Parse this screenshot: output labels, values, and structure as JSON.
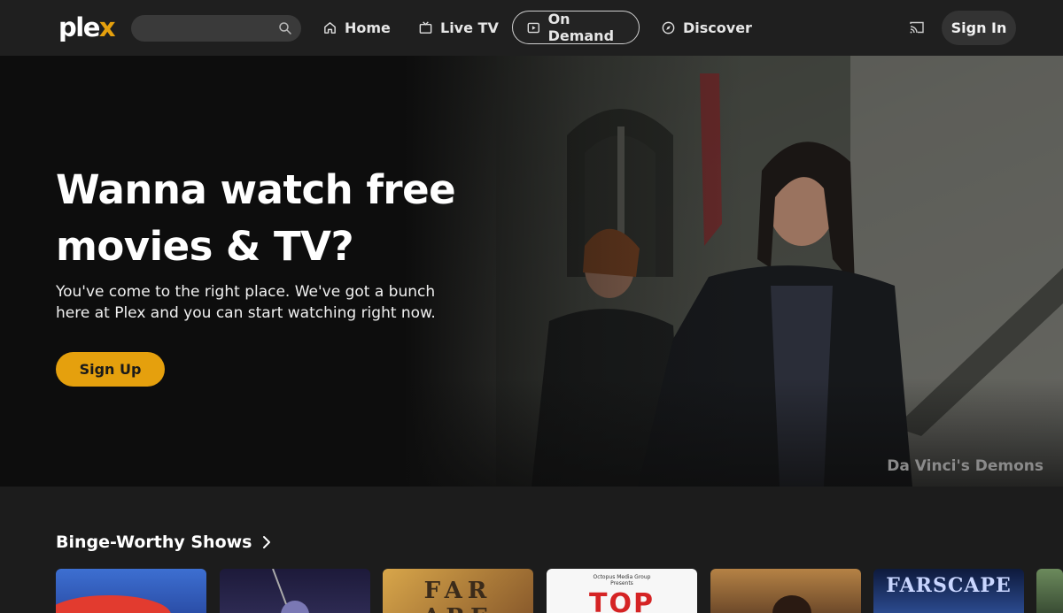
{
  "app": {
    "logo_text": "plex",
    "brand_color": "#e5a00d"
  },
  "nav": {
    "search": {
      "placeholder": "",
      "icon": "search-icon"
    },
    "items": [
      {
        "label": "Home",
        "icon": "home-icon"
      },
      {
        "label": "Live TV",
        "icon": "tv-icon"
      },
      {
        "label": "On Demand",
        "icon": "play-icon",
        "selected": true
      },
      {
        "label": "Discover",
        "icon": "compass-icon"
      }
    ],
    "cast_icon": "cast-icon",
    "sign_in_label": "Sign In"
  },
  "hero": {
    "title": "Wanna watch free movies & TV?",
    "description": "You've come to the right place. We've got a bunch here at Plex and you can start watching right now.",
    "cta_label": "Sign Up",
    "show_caption": "Da Vinci's Demons"
  },
  "row": {
    "title": "Binge-Worthy Shows",
    "cards": [
      {
        "text": ""
      },
      {
        "text": ""
      },
      {
        "text": "FAR  ARE"
      },
      {
        "text": "Octopus Media Group Presents",
        "text2": "TOP"
      },
      {
        "text": ""
      },
      {
        "text": "FARSCAPE"
      },
      {
        "text": ""
      }
    ]
  }
}
